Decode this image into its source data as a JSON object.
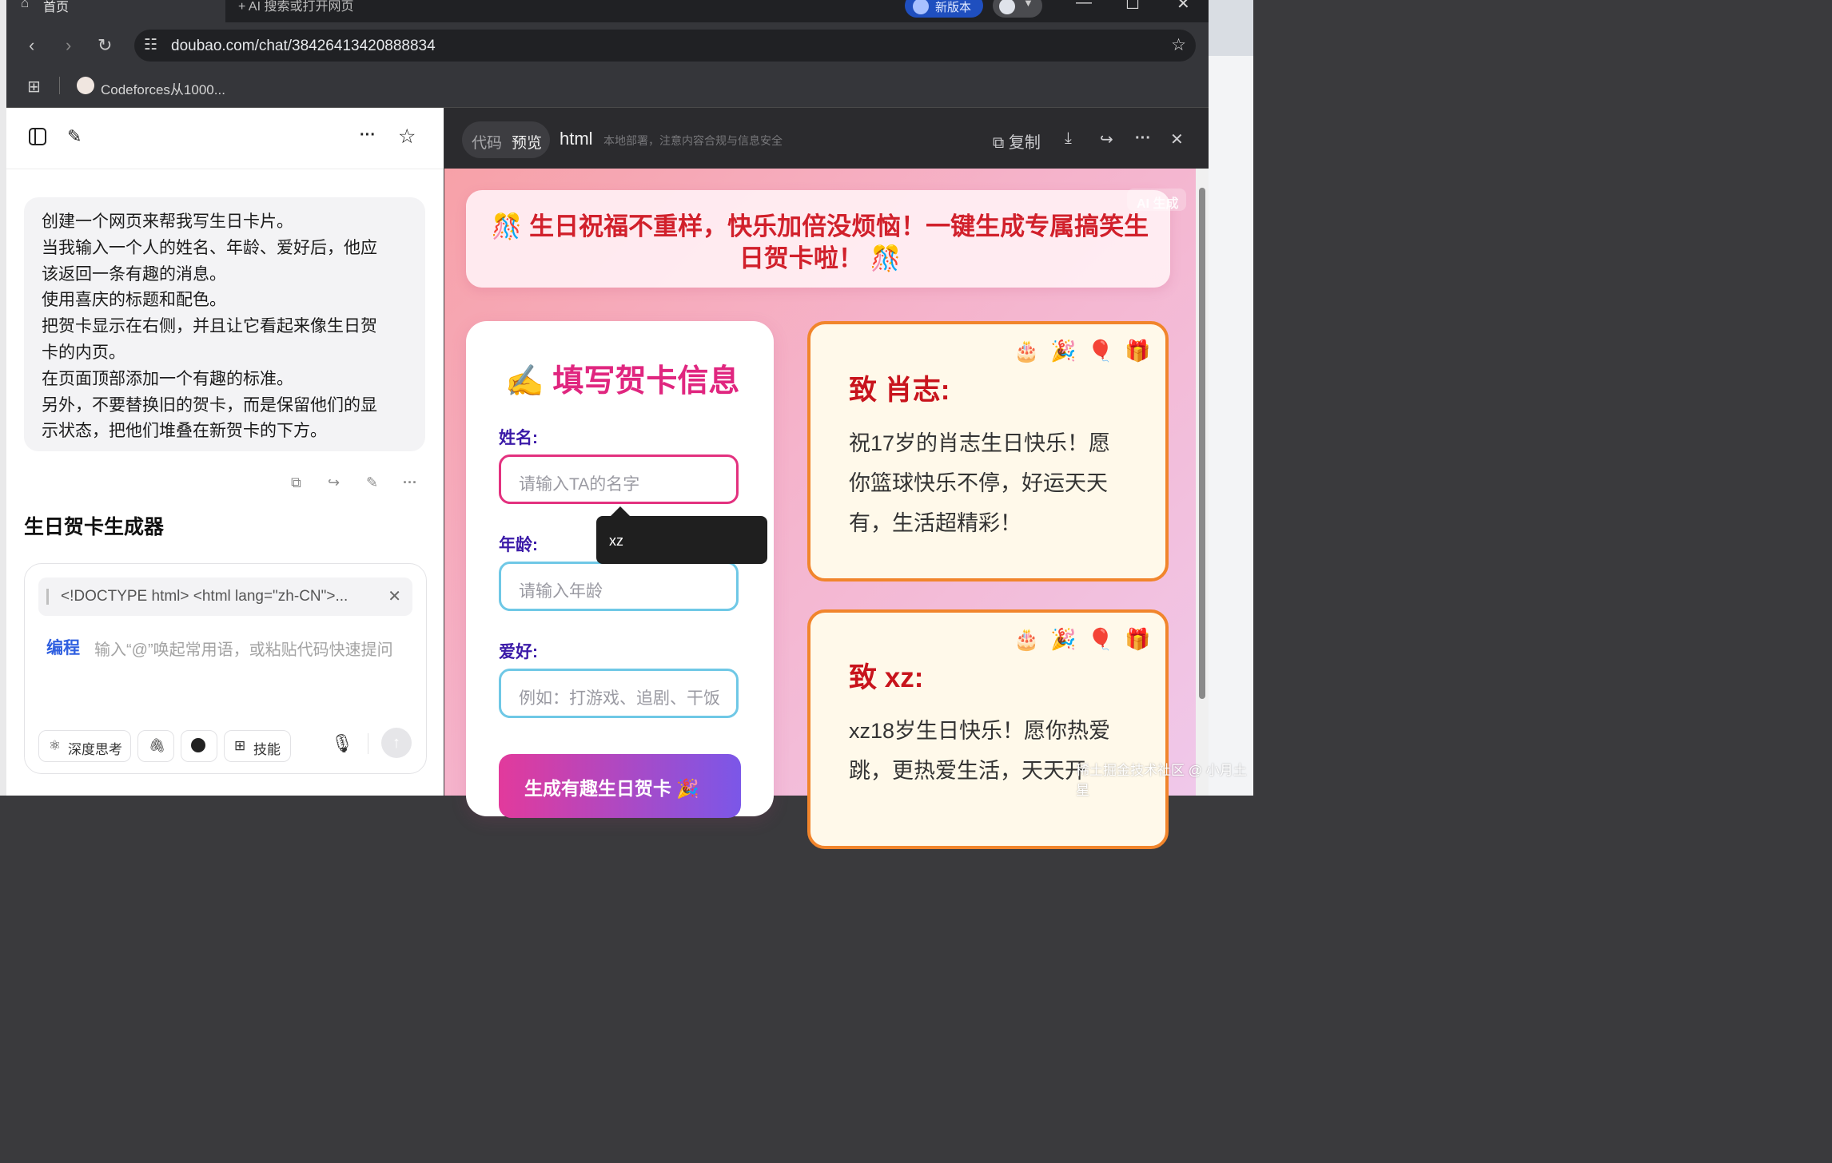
{
  "browser": {
    "active_tab": "首页",
    "new_tab": "AI 搜索或打开网页",
    "new_version_badge": "新版本",
    "url": "doubao.com/chat/38426413420888834",
    "bookmark": "Codeforces从1000..."
  },
  "chat": {
    "user_message": [
      "创建一个网页来帮我写生日卡片。",
      "当我输入一个人的姓名、年龄、爱好后，他应",
      "该返回一条有趣的消息。",
      "使用喜庆的标题和配色。",
      "把贺卡显示在右侧，并且让它看起来像生日贺",
      "卡的内页。",
      "在页面顶部添加一个有趣的标准。",
      "另外，不要替换旧的贺卡，而是保留他们的显",
      "示状态，把他们堆叠在新贺卡的下方。"
    ],
    "section_title": "生日贺卡生成器",
    "attachment_text": "<!DOCTYPE html> <html lang=\"zh-CN\">...",
    "mode_label": "编程",
    "input_placeholder": "输入“@”唤起常用语，或粘贴代码快速提问",
    "chips": {
      "deep_think": "深度思考",
      "skills": "技能"
    }
  },
  "preview_header": {
    "tab_code": "代码",
    "tab_preview": "预览",
    "title": "html",
    "subtitle": "本地部署，注意内容合规与信息安全",
    "copy_label": "复制"
  },
  "preview": {
    "banner": "🎊 生日祝福不重样，快乐加倍没烦恼！一键生成专属搞笑生日贺卡啦！ 🎊",
    "ai_mark": "AI 生成",
    "form": {
      "title": "✍️ 填写贺卡信息",
      "name_label": "姓名:",
      "name_placeholder": "请输入TA的名字",
      "age_label": "年龄:",
      "age_placeholder": "请输入年龄",
      "hobby_label": "爱好:",
      "hobby_placeholder": "例如：打游戏、追剧、干饭",
      "generate_button": "生成有趣生日贺卡 🎉",
      "autocomplete_suggestion": "xz"
    },
    "cards": [
      {
        "icons": "🎂🎉🎈🎁",
        "to": "致 肖志:",
        "message": "祝17岁的肖志生日快乐！愿你篮球快乐不停，好运天天有，生活超精彩！"
      },
      {
        "icons": "🎂🎉🎈🎁",
        "to": "致 xz:",
        "message": "xz18岁生日快乐！愿你热爱跳，更热爱生活，天天开"
      }
    ]
  },
  "watermark": "稀土掘金技术社区 @ 小月土星"
}
